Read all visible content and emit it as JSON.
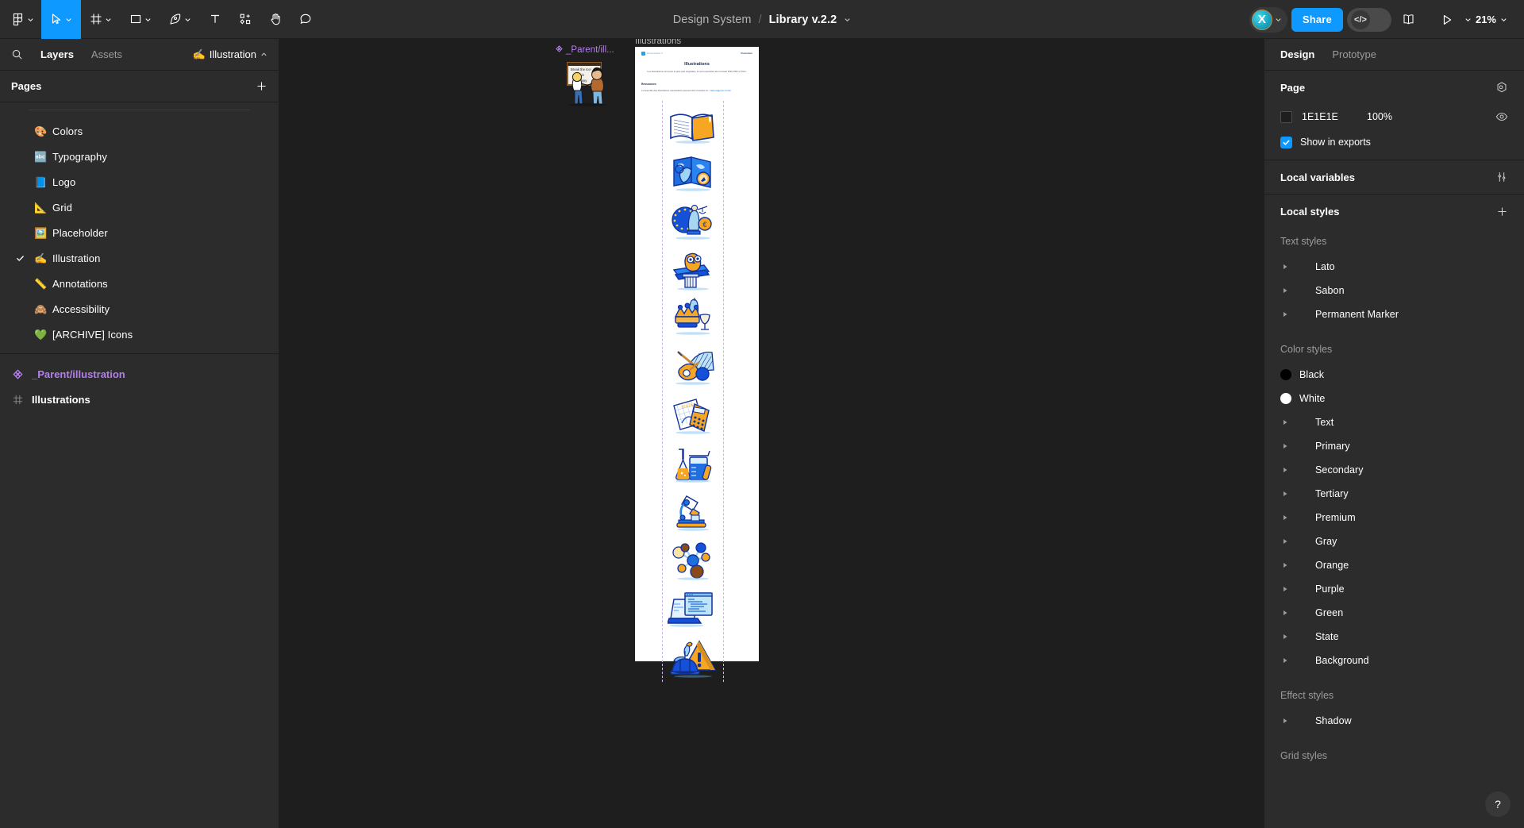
{
  "toolbar": {
    "menu_icon": "figma-logo-icon",
    "tools": [
      {
        "name": "move-tool",
        "icon": "cursor-icon",
        "has_caret": true,
        "active": true
      },
      {
        "name": "frame-tool",
        "icon": "frame-icon",
        "has_caret": true,
        "active": false
      },
      {
        "name": "shape-tool",
        "icon": "rectangle-icon",
        "has_caret": true,
        "active": false
      },
      {
        "name": "pen-tool",
        "icon": "pen-icon",
        "has_caret": true,
        "active": false
      },
      {
        "name": "text-tool",
        "icon": "text-icon",
        "has_caret": false,
        "active": false
      },
      {
        "name": "resources-tool",
        "icon": "components-icon",
        "has_caret": false,
        "active": false
      },
      {
        "name": "hand-tool",
        "icon": "hand-icon",
        "has_caret": false,
        "active": false
      },
      {
        "name": "comment-tool",
        "icon": "comment-bubble-icon",
        "has_caret": false,
        "active": false
      }
    ],
    "document_name": "Design System",
    "separator": "/",
    "file_name": "Library v.2.2",
    "avatar_initial": "X",
    "share_label": "Share",
    "dev_mode_icon": "code-icon",
    "dev_mode_glyph": "</>",
    "book_icon": "book-icon",
    "present_icon": "play-icon",
    "zoom_level": "21%"
  },
  "left_panel": {
    "search_icon": "search-icon",
    "tabs": [
      {
        "label": "Layers",
        "active": true
      },
      {
        "label": "Assets",
        "active": false
      }
    ],
    "current_page_chip": {
      "emoji": "✍️",
      "label": "Illustration",
      "caret": "chevron-up-icon"
    },
    "pages_title": "Pages",
    "add_page_icon": "plus-icon",
    "pages": [
      {
        "emoji": "🎨",
        "label": "Colors",
        "selected": false
      },
      {
        "emoji": "🔤",
        "label": "Typography",
        "selected": false
      },
      {
        "emoji": "📘",
        "label": "Logo",
        "selected": false
      },
      {
        "emoji": "📐",
        "label": "Grid",
        "selected": false
      },
      {
        "emoji": "🖼️",
        "label": "Placeholder",
        "selected": false
      },
      {
        "emoji": "✍️",
        "label": "Illustration",
        "selected": true
      },
      {
        "emoji": "📏",
        "label": "Annotations",
        "selected": false
      },
      {
        "emoji": "🙈",
        "label": "Accessibility",
        "selected": false
      },
      {
        "emoji": "💚",
        "label": "[ARCHIVE] Icons",
        "selected": false
      }
    ],
    "layers": [
      {
        "icon": "component-icon",
        "label": "_Parent/illustration",
        "type": "component"
      },
      {
        "icon": "frame-icon",
        "label": "Illustrations",
        "type": "frame"
      }
    ]
  },
  "canvas": {
    "component_label": "_Parent/ill...",
    "component_label_icon": "component-icon",
    "frame_label": "Illustrations",
    "sheet": {
      "brand_text": "lelivrescolaire.fr",
      "corner_text": "Illustration",
      "title": "Illustrations",
      "subtitle": "Les illustrations sont pour le plus part originales, et sont exportées aux formats PNG PDF et SVG.",
      "section_heading": "Ressources",
      "section_text": "L'ensemble des illustrations nécessaires peuvent être trouvées ici : ",
      "section_link": "cette page de ce lien",
      "illustrations": [
        "open-book-illustration",
        "world-map-compass-illustration",
        "justice-statue-euro-illustration",
        "owl-column-books-illustration",
        "crown-statue-chalice-illustration",
        "guitar-fan-music-illustration",
        "calculator-graph-math-illustration",
        "beaker-flask-chemistry-illustration",
        "microscope-illustration",
        "molecule-atom-illustration",
        "laptop-code-illustration",
        "hardhat-warning-plant-illustration"
      ]
    }
  },
  "right_panel": {
    "tabs": [
      {
        "label": "Design",
        "active": true
      },
      {
        "label": "Prototype",
        "active": false
      }
    ],
    "page_section": {
      "title": "Page",
      "settings_icon": "page-settings-icon",
      "fill_hex": "1E1E1E",
      "fill_color": "#1E1E1E",
      "fill_opacity": "100%",
      "visibility_icon": "eye-icon",
      "show_in_exports_label": "Show in exports",
      "show_in_exports_checked": true
    },
    "local_variables": {
      "title": "Local variables",
      "icon": "variables-icon"
    },
    "local_styles": {
      "title": "Local styles",
      "add_icon": "plus-icon",
      "groups": [
        {
          "group_label": "Text styles",
          "items": [
            {
              "name": "Lato",
              "kind": "folder"
            },
            {
              "name": "Sabon",
              "kind": "folder"
            },
            {
              "name": "Permanent Marker",
              "kind": "folder"
            }
          ]
        },
        {
          "group_label": "Color styles",
          "items": [
            {
              "name": "Black",
              "kind": "swatch",
              "color": "#000000"
            },
            {
              "name": "White",
              "kind": "swatch",
              "color": "#FFFFFF"
            },
            {
              "name": "Text",
              "kind": "folder"
            },
            {
              "name": "Primary",
              "kind": "folder"
            },
            {
              "name": "Secondary",
              "kind": "folder"
            },
            {
              "name": "Tertiary",
              "kind": "folder"
            },
            {
              "name": "Premium",
              "kind": "folder"
            },
            {
              "name": "Gray",
              "kind": "folder"
            },
            {
              "name": "Orange",
              "kind": "folder"
            },
            {
              "name": "Purple",
              "kind": "folder"
            },
            {
              "name": "Green",
              "kind": "folder"
            },
            {
              "name": "State",
              "kind": "folder"
            },
            {
              "name": "Background",
              "kind": "folder"
            }
          ]
        },
        {
          "group_label": "Effect styles",
          "items": [
            {
              "name": "Shadow",
              "kind": "folder"
            }
          ]
        },
        {
          "group_label": "Grid styles",
          "items": []
        }
      ]
    }
  },
  "help_button": {
    "label": "?",
    "name": "help-button"
  },
  "colors": {
    "accent_blue": "#0D99FF",
    "panel_bg": "#2C2C2C",
    "canvas_bg": "#1E1E1E",
    "component_purple": "#B37FEB"
  }
}
